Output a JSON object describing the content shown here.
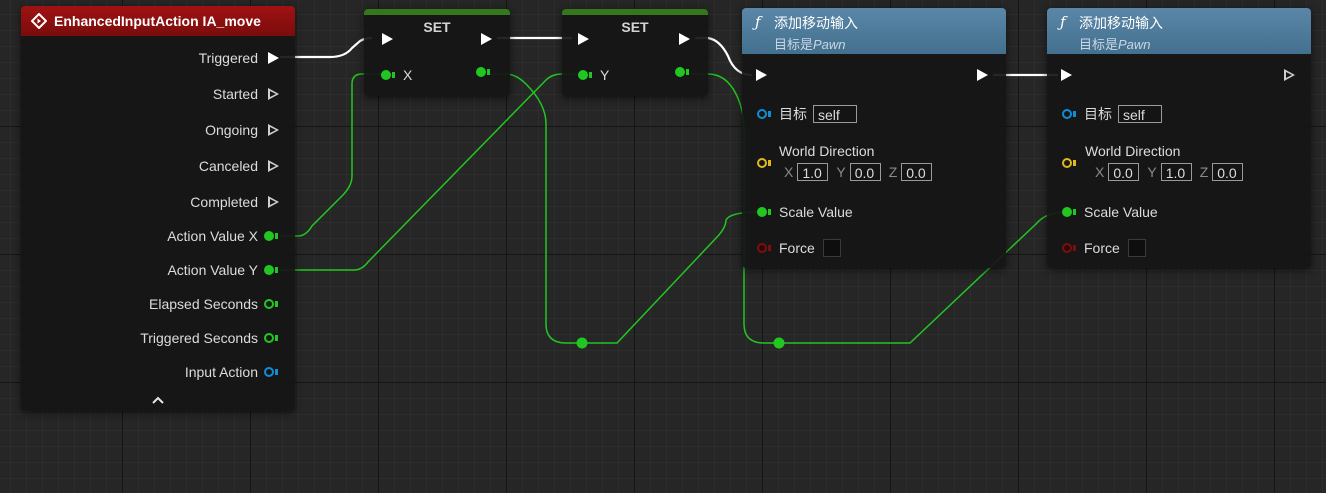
{
  "colors": {
    "event_header": "#8c0f0f",
    "set_header": "#33781c",
    "func_header": "#4e7a99",
    "float_wire": "#21c720",
    "exec_wire": "#ffffff",
    "object_pin": "#0e8ed6",
    "vector_pin": "#e0b81d",
    "bool_pin": "#7d0e0e"
  },
  "event_node": {
    "title": "EnhancedInputAction IA_move",
    "icon": "event-diamond-icon",
    "pins": [
      {
        "label": "Triggered",
        "type": "exec",
        "connected": true
      },
      {
        "label": "Started",
        "type": "exec",
        "connected": false
      },
      {
        "label": "Ongoing",
        "type": "exec",
        "connected": false
      },
      {
        "label": "Canceled",
        "type": "exec",
        "connected": false
      },
      {
        "label": "Completed",
        "type": "exec",
        "connected": false
      },
      {
        "label": "Action Value X",
        "type": "float",
        "connected": true
      },
      {
        "label": "Action Value Y",
        "type": "float",
        "connected": true
      },
      {
        "label": "Elapsed Seconds",
        "type": "float",
        "connected": false
      },
      {
        "label": "Triggered Seconds",
        "type": "float",
        "connected": false
      },
      {
        "label": "Input Action",
        "type": "object",
        "connected": false
      }
    ],
    "collapse_icon": "chevron-up-icon"
  },
  "set_nodes": [
    {
      "title": "SET",
      "var": "X"
    },
    {
      "title": "SET",
      "var": "Y"
    }
  ],
  "func_nodes": [
    {
      "icon": "function-icon",
      "title": "添加移动输入",
      "subtitle_prefix": "目标是",
      "subtitle_class": "Pawn",
      "target_label": "目标",
      "target_value": "self",
      "direction_label": "World Direction",
      "x_label": "X",
      "x": "1.0",
      "y_label": "Y",
      "y": "0.0",
      "z_label": "Z",
      "z": "0.0",
      "scale_label": "Scale Value",
      "force_label": "Force"
    },
    {
      "icon": "function-icon",
      "title": "添加移动输入",
      "subtitle_prefix": "目标是",
      "subtitle_class": "Pawn",
      "target_label": "目标",
      "target_value": "self",
      "direction_label": "World Direction",
      "x_label": "X",
      "x": "0.0",
      "y_label": "Y",
      "y": "1.0",
      "z_label": "Z",
      "z": "0.0",
      "scale_label": "Scale Value",
      "force_label": "Force"
    }
  ]
}
